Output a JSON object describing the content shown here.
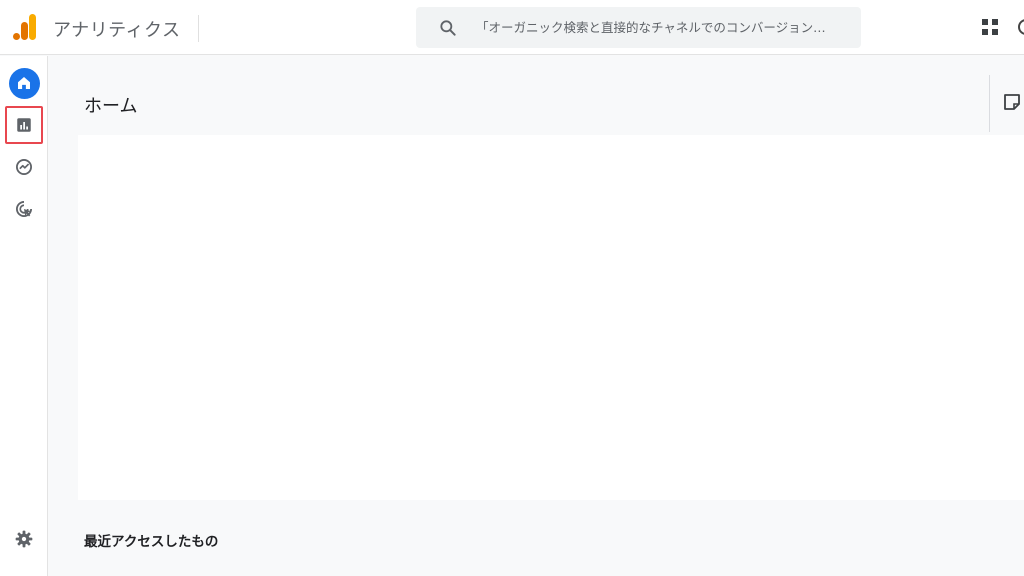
{
  "app": {
    "title": "アナリティクス"
  },
  "search": {
    "placeholder": "「オーガニック検索と直接的なチャネルでのコンバージョン…"
  },
  "sidebar": {
    "items": [
      {
        "name": "home",
        "icon": "home-icon",
        "selected": true
      },
      {
        "name": "reports",
        "icon": "bar-chart-icon",
        "highlighted": true
      },
      {
        "name": "explore",
        "icon": "explore-icon"
      },
      {
        "name": "advertising",
        "icon": "advertising-icon"
      },
      {
        "name": "admin",
        "icon": "gear-icon"
      }
    ]
  },
  "main": {
    "heading": "ホーム",
    "recent_heading": "最近アクセスしたもの"
  },
  "colors": {
    "accent": "#1a73e8",
    "highlight_box": "#e8474f",
    "logo_orange": "#f9ab00",
    "logo_dark_orange": "#e37400"
  }
}
